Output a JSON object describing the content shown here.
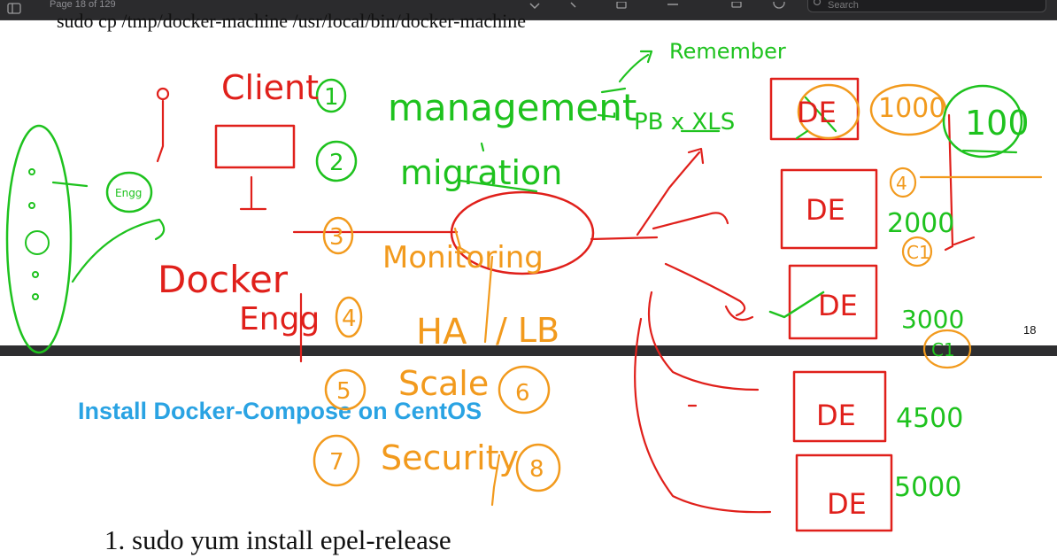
{
  "toolbar": {
    "page_indicator": "Page 18 of 129",
    "search_placeholder": "Search"
  },
  "slide_top": {
    "command": "sudo cp /tmp/docker-machine /usr/local/bin/docker-machine",
    "page_number": "18"
  },
  "slide_bottom": {
    "heading": "Install Docker-Compose on CentOS",
    "list_item": "1. sudo  yum install epel-release"
  },
  "annotations": {
    "client": "Client",
    "docker": "Docker",
    "engg_left": "Engg",
    "engg_small": "Engg",
    "n1": "1",
    "n2": "2",
    "n3": "3",
    "n4": "4",
    "n5": "5",
    "n6": "6",
    "n7": "7",
    "n8": "8",
    "management": "management",
    "migration": "migration",
    "monitoring": "Monitoring",
    "ha": "HA",
    "lb": "/ LB",
    "scale": "Scale",
    "security": "Security",
    "remember": "Remember",
    "pb_xls": "PB x XLS",
    "de1": "DE",
    "de2": "DE",
    "de3": "DE",
    "de4": "DE",
    "de5": "DE",
    "v1000": "1000",
    "v100": "100",
    "v4": "4",
    "v2000": "2000",
    "c1a": "C1",
    "v3000": "3000",
    "c1b": "C1",
    "v4500": "4500",
    "v5000": "5000",
    "colors": {
      "red": "#e0201b",
      "green": "#1ec21e",
      "orange": "#f29a1d"
    }
  }
}
